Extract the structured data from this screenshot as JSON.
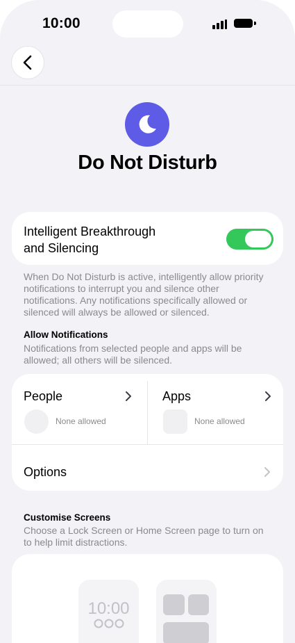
{
  "status": {
    "time": "10:00"
  },
  "nav": {
    "back_label": "Back"
  },
  "header": {
    "title": "Do Not Disturb"
  },
  "breakthrough": {
    "line1": "Intelligent Breakthrough",
    "line2": "and Silencing",
    "enabled": true,
    "description": "When Do Not Disturb is active, intelligently allow priority notifications to interrupt you and silence other notifications. Any notifications specifically allowed or silenced will always be allowed or silenced."
  },
  "allow_notifications": {
    "heading": "Allow Notifications",
    "description": "Notifications from selected people and apps will be allowed; all others will be silenced.",
    "people": {
      "label": "People",
      "status": "None allowed"
    },
    "apps": {
      "label": "Apps",
      "status": "None allowed"
    },
    "options": {
      "label": "Options"
    }
  },
  "customise_screens": {
    "heading": "Customise Screens",
    "description": "Choose a Lock Screen or Home Screen page to turn on to help limit distractions.",
    "lock_screen_time": "10:00"
  },
  "colors": {
    "accent": "#5e5ce6",
    "toggle_on": "#34c759",
    "background": "#f2f2f7"
  },
  "icons": [
    "back-chevron-icon",
    "moon-icon",
    "chevron-right-icon",
    "signal-icon",
    "battery-icon"
  ]
}
